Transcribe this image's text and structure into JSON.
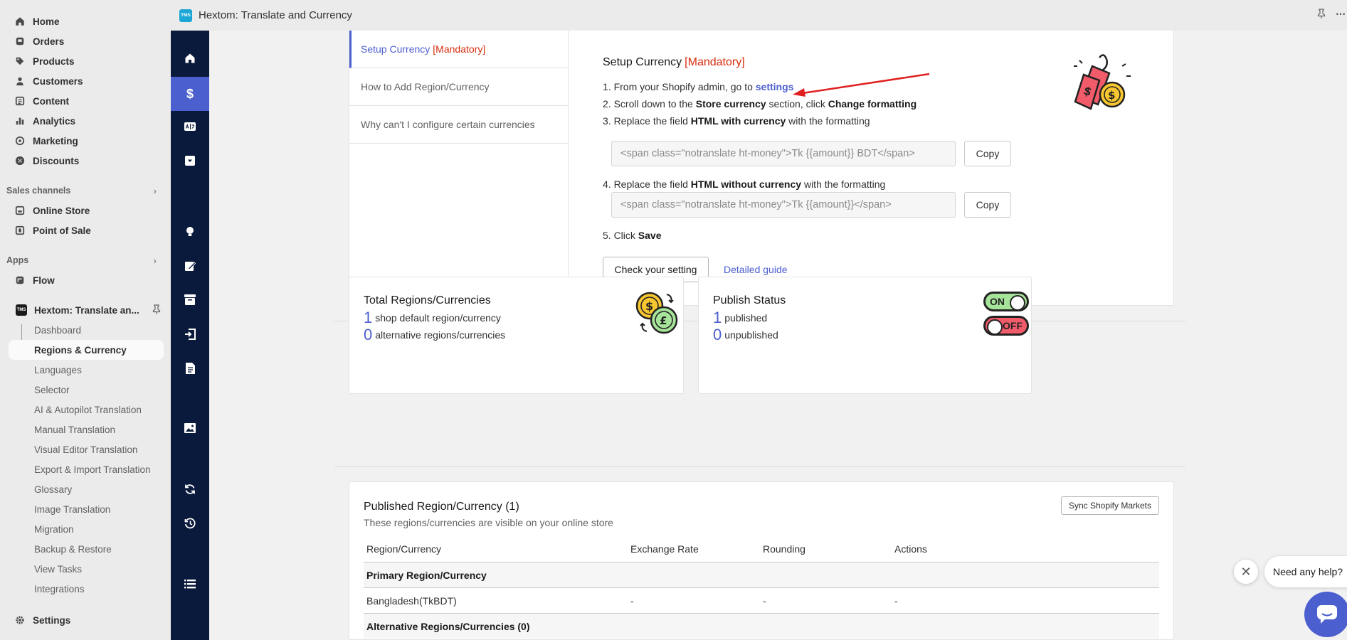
{
  "sidebar": {
    "main_items": [
      {
        "label": "Home",
        "icon": "home-icon"
      },
      {
        "label": "Orders",
        "icon": "orders-icon"
      },
      {
        "label": "Products",
        "icon": "tag-icon"
      },
      {
        "label": "Customers",
        "icon": "person-icon"
      },
      {
        "label": "Content",
        "icon": "content-icon"
      },
      {
        "label": "Analytics",
        "icon": "analytics-icon"
      },
      {
        "label": "Marketing",
        "icon": "marketing-icon"
      },
      {
        "label": "Discounts",
        "icon": "discount-icon"
      }
    ],
    "sales_channels_label": "Sales channels",
    "sales_channels": [
      {
        "label": "Online Store",
        "icon": "store-icon"
      },
      {
        "label": "Point of Sale",
        "icon": "pos-icon"
      }
    ],
    "apps_label": "Apps",
    "apps": [
      {
        "label": "Flow",
        "icon": "flow-icon"
      }
    ],
    "app_logo_text": "TMS",
    "app_name": "Hextom: Translate an...",
    "app_sub_items": [
      "Dashboard",
      "Regions & Currency",
      "Languages",
      "Selector",
      "AI & Autopilot Translation",
      "Manual Translation",
      "Visual Editor Translation",
      "Export & Import Translation",
      "Glossary",
      "Image Translation",
      "Migration",
      "Backup & Restore",
      "View Tasks",
      "Integrations"
    ],
    "active_sub_item": "Regions & Currency",
    "settings_label": "Settings"
  },
  "topbar": {
    "logo_text": "TMS",
    "title": "Hextom: Translate and Currency"
  },
  "app_nav": {
    "icons": [
      "home-icon",
      "dollar-icon",
      "language-icon",
      "dropdown-icon",
      "bulb-icon",
      "edit-icon",
      "archive-icon",
      "import-icon",
      "document-icon",
      "image-icon",
      "sync-icon",
      "history-icon",
      "list-icon"
    ],
    "active": "dollar-icon",
    "dollar_glyph": "$"
  },
  "guide": {
    "tabs": [
      {
        "label": "Setup Currency",
        "mandatory": "[Mandatory]"
      },
      {
        "label": "How to Add Region/Currency"
      },
      {
        "label": "Why can't I configure certain currencies"
      }
    ],
    "heading": "Setup Currency",
    "heading_mandatory": "[Mandatory]",
    "step1_prefix": "1. From your Shopify admin, go to ",
    "step1_link": "settings",
    "step2_prefix": "2. Scroll down to the ",
    "step2_b1": "Store currency",
    "step2_mid": " section, click ",
    "step2_b2": "Change formatting",
    "step3_prefix": "3. Replace the field ",
    "step3_b": "HTML with currency",
    "step3_suffix": " with the formatting",
    "step3_value": "<span class=\"notranslate ht-money\">Tk {{amount}} BDT</span>",
    "step4_prefix": "4. Replace the field ",
    "step4_b": "HTML without currency",
    "step4_suffix": " with the formatting",
    "step4_value": "<span class=\"notranslate ht-money\">Tk {{amount}}</span>",
    "copy_label": "Copy",
    "step5_prefix": "5. Click ",
    "step5_b": "Save",
    "check_button": "Check your setting",
    "detailed_guide": "Detailed guide"
  },
  "total_card": {
    "title": "Total Regions/Currencies",
    "default_count": "1",
    "default_label": "shop default region/currency",
    "alt_count": "0",
    "alt_label": "alternative regions/currencies"
  },
  "publish_card": {
    "title": "Publish Status",
    "published_count": "1",
    "published_label": "published",
    "unpublished_count": "0",
    "unpublished_label": "unpublished",
    "on_label": "ON",
    "off_label": "OFF"
  },
  "published_card": {
    "title": "Published Region/Currency (1)",
    "subtitle": "These regions/currencies are visible on your online store",
    "sync_button": "Sync Shopify Markets",
    "columns": [
      "Region/Currency",
      "Exchange Rate",
      "Rounding",
      "Actions"
    ],
    "primary_group": "Primary Region/Currency",
    "rows": [
      {
        "region": "Bangladesh(TkBDT)",
        "rate": "-",
        "rounding": "-",
        "actions": "-"
      }
    ],
    "alt_group": "Alternative Regions/Currencies (0)"
  },
  "chat": {
    "bubble": "Need any help?",
    "close_glyph": "✕"
  },
  "colors": {
    "accent": "#4c5fcf",
    "mandatory": "#d72c0d",
    "app_nav_bg": "#0a1a3c"
  }
}
